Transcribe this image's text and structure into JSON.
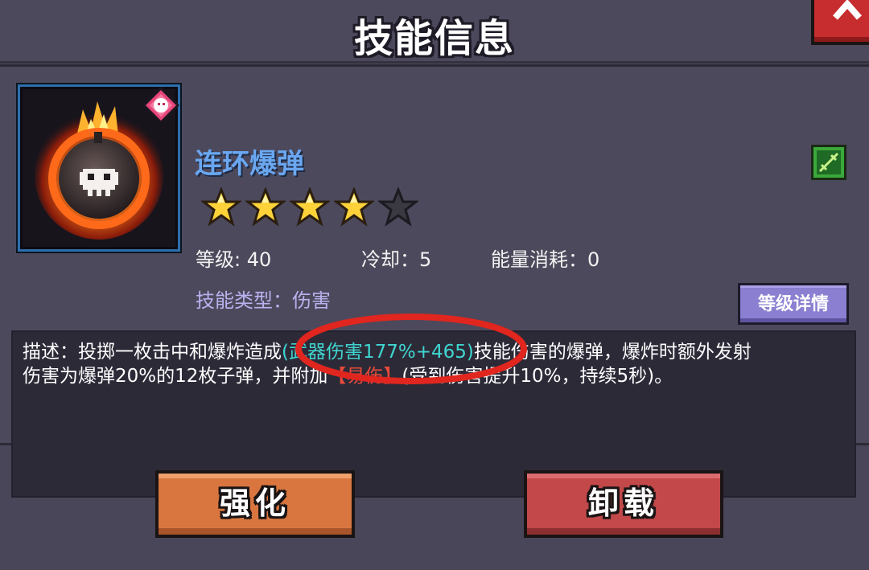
{
  "header": {
    "title": "技能信息",
    "close_icon": "chevron-up-icon"
  },
  "skill": {
    "name": "连环爆弹",
    "icon": "flaming-bomb-icon",
    "element_badge_icon": "element-badge-icon",
    "weapon_type_icon": "weapon-type-icon",
    "stars_filled": 4,
    "stars_total": 5,
    "level_label": "等级: 40",
    "cooldown_label": "冷却：5",
    "energy_label": "能量消耗：0",
    "type_label": "技能类型：伤害",
    "level_details_button": "等级详情"
  },
  "description": {
    "line1_prefix": "描述：投掷一枚击中和爆炸造成",
    "highlight": "(武器伤害177%+465)",
    "line1_suffix": "技能伤害的爆弹，爆炸时额外发射",
    "line2_prefix": "伤害为爆弹20%的12枚子弹，并附加",
    "debuff": "【易伤】",
    "line2_suffix": "(受到伤害提升10%，持续5秒)。"
  },
  "buttons": {
    "upgrade": "强化",
    "unload": "卸载"
  },
  "colors": {
    "background": "#4a4659",
    "skill_name": "#6aa7f0",
    "highlight": "#3fd6d0",
    "upgrade_button": "#d9763f",
    "unload_button": "#c2484a",
    "details_button": "#8a7fd1",
    "annotation_ellipse": "#e0261e"
  }
}
